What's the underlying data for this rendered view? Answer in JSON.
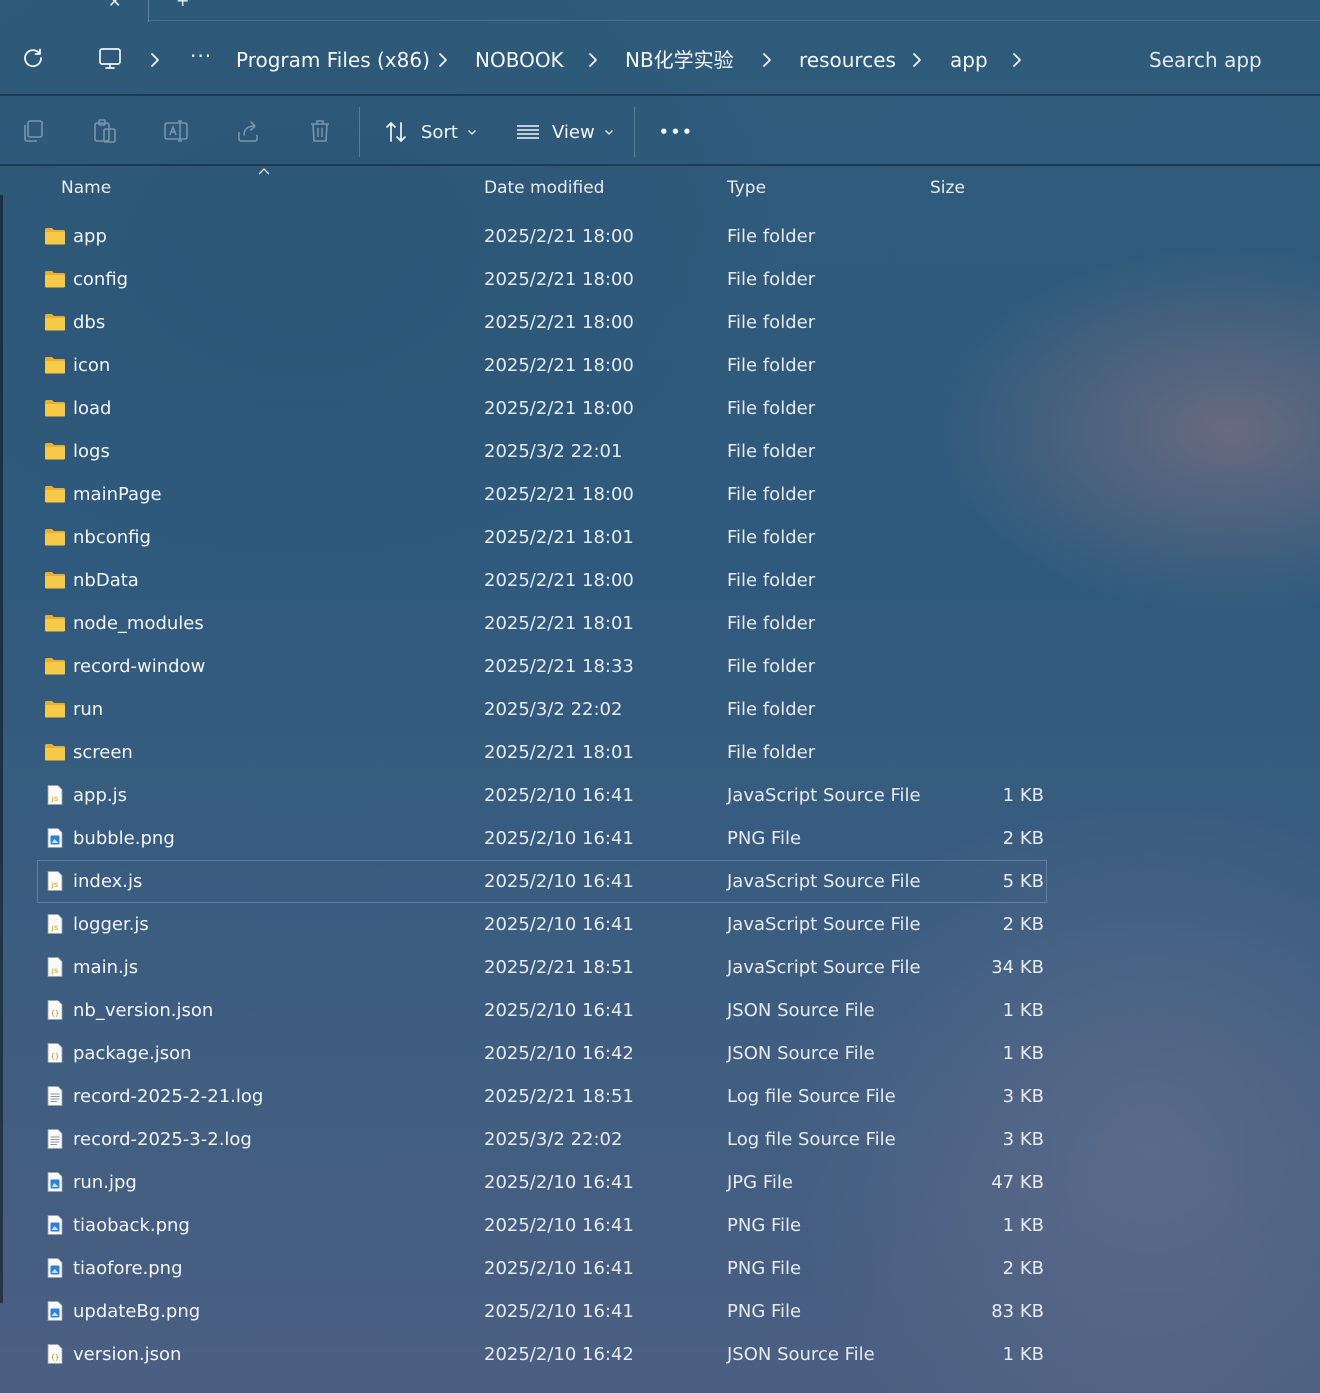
{
  "tabs": {
    "close_glyph": "✕",
    "new_glyph": "+"
  },
  "breadcrumb": {
    "overflow": "···",
    "items": [
      {
        "label": "Program Files (x86)"
      },
      {
        "label": "NOBOOK"
      },
      {
        "label": "NB化学实验"
      },
      {
        "label": "resources"
      },
      {
        "label": "app"
      }
    ]
  },
  "search": {
    "placeholder": "Search app"
  },
  "toolbar": {
    "sort_label": "Sort",
    "view_label": "View",
    "more_glyph": "•••"
  },
  "columns": {
    "name": "Name",
    "date": "Date modified",
    "type": "Type",
    "size": "Size"
  },
  "files": [
    {
      "name": "app",
      "date": "2025/2/21 18:00",
      "type": "File folder",
      "size": "",
      "icon": "folder-icon"
    },
    {
      "name": "config",
      "date": "2025/2/21 18:00",
      "type": "File folder",
      "size": "",
      "icon": "folder-icon"
    },
    {
      "name": "dbs",
      "date": "2025/2/21 18:00",
      "type": "File folder",
      "size": "",
      "icon": "folder-icon"
    },
    {
      "name": "icon",
      "date": "2025/2/21 18:00",
      "type": "File folder",
      "size": "",
      "icon": "folder-icon"
    },
    {
      "name": "load",
      "date": "2025/2/21 18:00",
      "type": "File folder",
      "size": "",
      "icon": "folder-icon"
    },
    {
      "name": "logs",
      "date": "2025/3/2 22:01",
      "type": "File folder",
      "size": "",
      "icon": "folder-icon"
    },
    {
      "name": "mainPage",
      "date": "2025/2/21 18:00",
      "type": "File folder",
      "size": "",
      "icon": "folder-icon"
    },
    {
      "name": "nbconfig",
      "date": "2025/2/21 18:01",
      "type": "File folder",
      "size": "",
      "icon": "folder-icon"
    },
    {
      "name": "nbData",
      "date": "2025/2/21 18:00",
      "type": "File folder",
      "size": "",
      "icon": "folder-icon"
    },
    {
      "name": "node_modules",
      "date": "2025/2/21 18:01",
      "type": "File folder",
      "size": "",
      "icon": "folder-icon"
    },
    {
      "name": "record-window",
      "date": "2025/2/21 18:33",
      "type": "File folder",
      "size": "",
      "icon": "folder-icon"
    },
    {
      "name": "run",
      "date": "2025/3/2 22:02",
      "type": "File folder",
      "size": "",
      "icon": "folder-icon"
    },
    {
      "name": "screen",
      "date": "2025/2/21 18:01",
      "type": "File folder",
      "size": "",
      "icon": "folder-icon"
    },
    {
      "name": "app.js",
      "date": "2025/2/10 16:41",
      "type": "JavaScript Source File",
      "size": "1 KB",
      "icon": "js-file-icon"
    },
    {
      "name": "bubble.png",
      "date": "2025/2/10 16:41",
      "type": "PNG File",
      "size": "2 KB",
      "icon": "image-file-icon"
    },
    {
      "name": "index.js",
      "date": "2025/2/10 16:41",
      "type": "JavaScript Source File",
      "size": "5 KB",
      "icon": "js-file-icon",
      "selected": true
    },
    {
      "name": "logger.js",
      "date": "2025/2/10 16:41",
      "type": "JavaScript Source File",
      "size": "2 KB",
      "icon": "js-file-icon"
    },
    {
      "name": "main.js",
      "date": "2025/2/21 18:51",
      "type": "JavaScript Source File",
      "size": "34 KB",
      "icon": "js-file-icon"
    },
    {
      "name": "nb_version.json",
      "date": "2025/2/10 16:41",
      "type": "JSON Source File",
      "size": "1 KB",
      "icon": "json-file-icon"
    },
    {
      "name": "package.json",
      "date": "2025/2/10 16:42",
      "type": "JSON Source File",
      "size": "1 KB",
      "icon": "json-file-icon"
    },
    {
      "name": "record-2025-2-21.log",
      "date": "2025/2/21 18:51",
      "type": "Log file Source File",
      "size": "3 KB",
      "icon": "log-file-icon"
    },
    {
      "name": "record-2025-3-2.log",
      "date": "2025/3/2 22:02",
      "type": "Log file Source File",
      "size": "3 KB",
      "icon": "log-file-icon"
    },
    {
      "name": "run.jpg",
      "date": "2025/2/10 16:41",
      "type": "JPG File",
      "size": "47 KB",
      "icon": "image-file-icon"
    },
    {
      "name": "tiaoback.png",
      "date": "2025/2/10 16:41",
      "type": "PNG File",
      "size": "1 KB",
      "icon": "image-file-icon"
    },
    {
      "name": "tiaofore.png",
      "date": "2025/2/10 16:41",
      "type": "PNG File",
      "size": "2 KB",
      "icon": "image-file-icon"
    },
    {
      "name": "updateBg.png",
      "date": "2025/2/10 16:41",
      "type": "PNG File",
      "size": "83 KB",
      "icon": "image-file-icon"
    },
    {
      "name": "version.json",
      "date": "2025/2/10 16:42",
      "type": "JSON Source File",
      "size": "1 KB",
      "icon": "json-file-icon"
    }
  ],
  "colors": {
    "folder": "#f7c948",
    "folder_tab": "#e8b030",
    "text": "#f2f5f8",
    "js_badge": "#d9c44a",
    "image_badge": "#2f7fd8"
  }
}
